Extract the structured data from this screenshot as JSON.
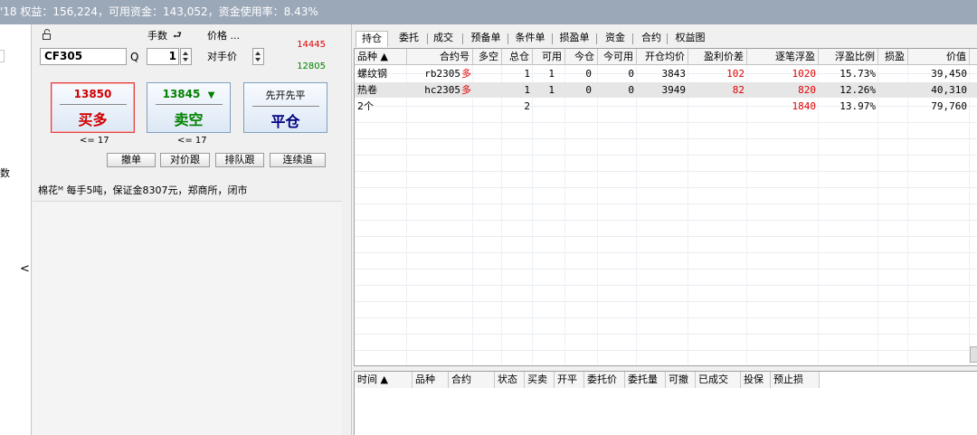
{
  "topbar": {
    "text": "'18  权益：156,224，可用资金：143,052，资金使用率：8.43%"
  },
  "left_strip": {
    "fragment": "数",
    "collapse_glyph": "<"
  },
  "order_panel": {
    "qty_label": "手数",
    "price_label": "价格 ...",
    "price_type": "对手价",
    "instrument": "CF305",
    "quantity": "1",
    "upper_price": "14445",
    "lower_price": "12805",
    "buy": {
      "price": "13850",
      "action": "买多"
    },
    "sell": {
      "price": "13845",
      "arrow": "▼",
      "action": "卖空"
    },
    "close": {
      "mode": "先开先平",
      "action": "平仓"
    },
    "buy_limit": "<= 17",
    "sell_limit": "<= 17",
    "buttons": {
      "cancel": "撤单",
      "chase_opponent": "对价跟",
      "chase_queue": "排队跟",
      "chase_continuous": "连续追"
    },
    "info": "棉花ᴹ 每手5吨，保证金8307元，郑商所，闭市"
  },
  "tabs": [
    "持仓",
    "委托",
    "成交",
    "预备单",
    "条件单",
    "损盈单",
    "资金",
    "合约",
    "权益图"
  ],
  "positions": {
    "columns": [
      "品种 ▲",
      "合约号",
      "多空",
      "总仓",
      "可用",
      "今仓",
      "今可用",
      "开仓均价",
      "盈利价差",
      "逐笔浮盈",
      "浮盈比例",
      "损盈",
      "价值"
    ],
    "rows": [
      {
        "name": "螺纹钢",
        "contract": "rb2305",
        "dir": "多",
        "total": "1",
        "avail": "1",
        "today": "0",
        "today_avail": "0",
        "open_avg": "3843",
        "diff": "102",
        "float_pnl": "1020",
        "ratio": "15.73%",
        "sl": "",
        "value": "39,450"
      },
      {
        "name": "热卷",
        "contract": "hc2305",
        "dir": "多",
        "total": "1",
        "avail": "1",
        "today": "0",
        "today_avail": "0",
        "open_avg": "3949",
        "diff": "82",
        "float_pnl": "820",
        "ratio": "12.26%",
        "sl": "",
        "value": "40,310"
      }
    ],
    "summary": {
      "name": "2个",
      "total": "2",
      "float_pnl": "1840",
      "ratio": "13.97%",
      "value": "79,760"
    }
  },
  "orders": {
    "columns": [
      "时间 ▲",
      "品种",
      "合约",
      "状态",
      "买卖",
      "开平",
      "委托价",
      "委托量",
      "可撤",
      "已成交",
      "投保",
      "预止损"
    ]
  },
  "colors": {
    "topbar": "#9ba8b8",
    "profit": "#e00000",
    "sell": "#008000"
  }
}
